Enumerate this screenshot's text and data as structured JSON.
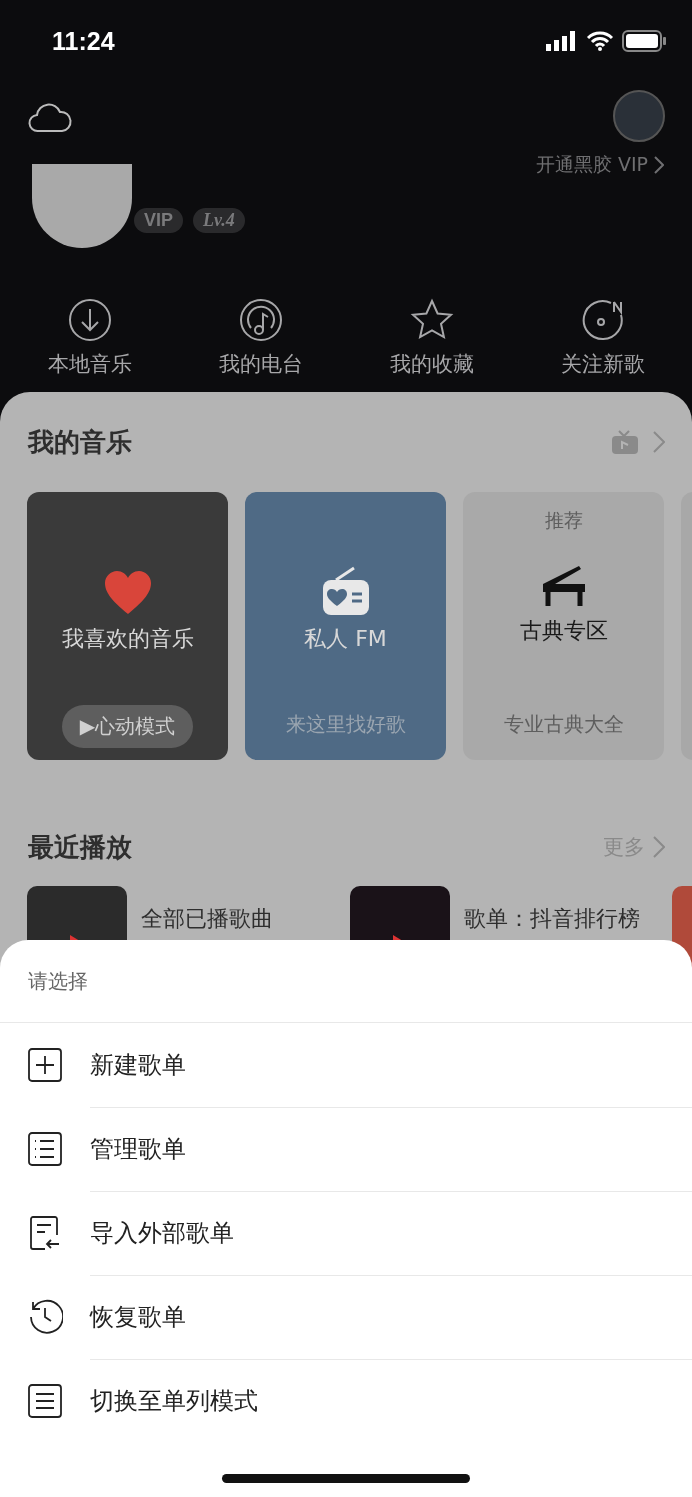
{
  "status_bar": {
    "time": "11:24"
  },
  "header": {
    "vip_link": "开通黑胶 VIP",
    "badges": [
      {
        "kind": "vip",
        "text": "VIP"
      },
      {
        "kind": "level",
        "text": "Lv.4"
      }
    ]
  },
  "shortcuts": [
    {
      "kind": "download",
      "label": "本地音乐"
    },
    {
      "kind": "radio",
      "label": "我的电台"
    },
    {
      "kind": "star",
      "label": "我的收藏"
    },
    {
      "kind": "new",
      "label": "关注新歌"
    }
  ],
  "my_music": {
    "title": "我的音乐",
    "cards": [
      {
        "kind": "liked",
        "title": "我喜欢的音乐",
        "action": "▶心动模式"
      },
      {
        "kind": "fm",
        "title": "私人 FM",
        "subtitle": "来这里找好歌"
      },
      {
        "kind": "classical",
        "tag": "推荐",
        "title": "古典专区",
        "subtitle": "专业古典大全"
      }
    ]
  },
  "recent": {
    "title": "最近播放",
    "more": "更多",
    "items": [
      {
        "kind": "dark",
        "title": "全部已播歌曲"
      },
      {
        "kind": "tiktok",
        "title": "歌单：抖音排行榜"
      }
    ]
  },
  "sheet": {
    "title": "请选择",
    "options": [
      {
        "label": "新建歌单"
      },
      {
        "label": "管理歌单"
      },
      {
        "label": "导入外部歌单"
      },
      {
        "label": "恢复歌单"
      },
      {
        "label": "切换至单列模式"
      }
    ]
  }
}
